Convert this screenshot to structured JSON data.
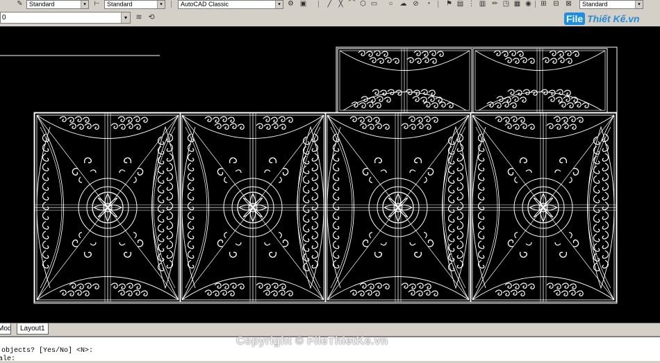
{
  "toolbar": {
    "text_style": "Standard",
    "dim_style": "Standard",
    "workspace": "AutoCAD Classic",
    "table_style": "Standard"
  },
  "layer": {
    "current": "0"
  },
  "logo": {
    "file": "File",
    "rest": "Thiết Kế.vn"
  },
  "tabs": [
    {
      "label": "Model"
    },
    {
      "label": "Layout1"
    }
  ],
  "command": {
    "line1": "objects? [Yes/No] <N>:",
    "line2": "Scale:"
  },
  "watermark": "Copyright © FileThietKe.vn",
  "colors": {
    "canvas": "#000000",
    "lines": "#ffffff",
    "accent": "#1e8ee0"
  }
}
